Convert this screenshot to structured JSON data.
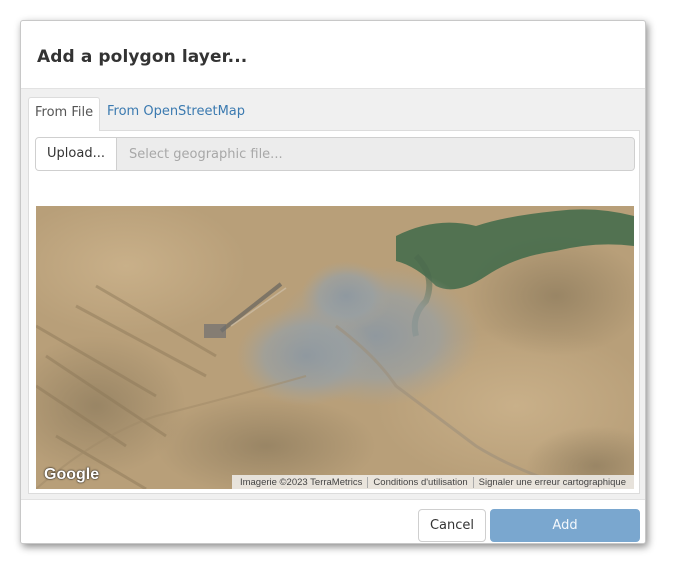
{
  "dialog": {
    "title": "Add a polygon layer..."
  },
  "tabs": [
    {
      "label": "From File",
      "active": true
    },
    {
      "label": "From OpenStreetMap",
      "active": false
    }
  ],
  "file_picker": {
    "upload_label": "Upload...",
    "placeholder": "Select geographic file...",
    "value": ""
  },
  "map": {
    "logo": "Google",
    "imagery_type": "satellite",
    "attribution": [
      "Imagerie ©2023 TerraMetrics",
      "Conditions d'utilisation",
      "Signaler une erreur cartographique"
    ]
  },
  "footer": {
    "cancel_label": "Cancel",
    "add_label": "Add",
    "add_enabled": false
  },
  "colors": {
    "accent": "#3b7ab0",
    "add_button_disabled": "#7aa7cf",
    "terrain": "#bba07a",
    "urban": "#8f9aa2",
    "vegetation": "#3f6a4a"
  }
}
